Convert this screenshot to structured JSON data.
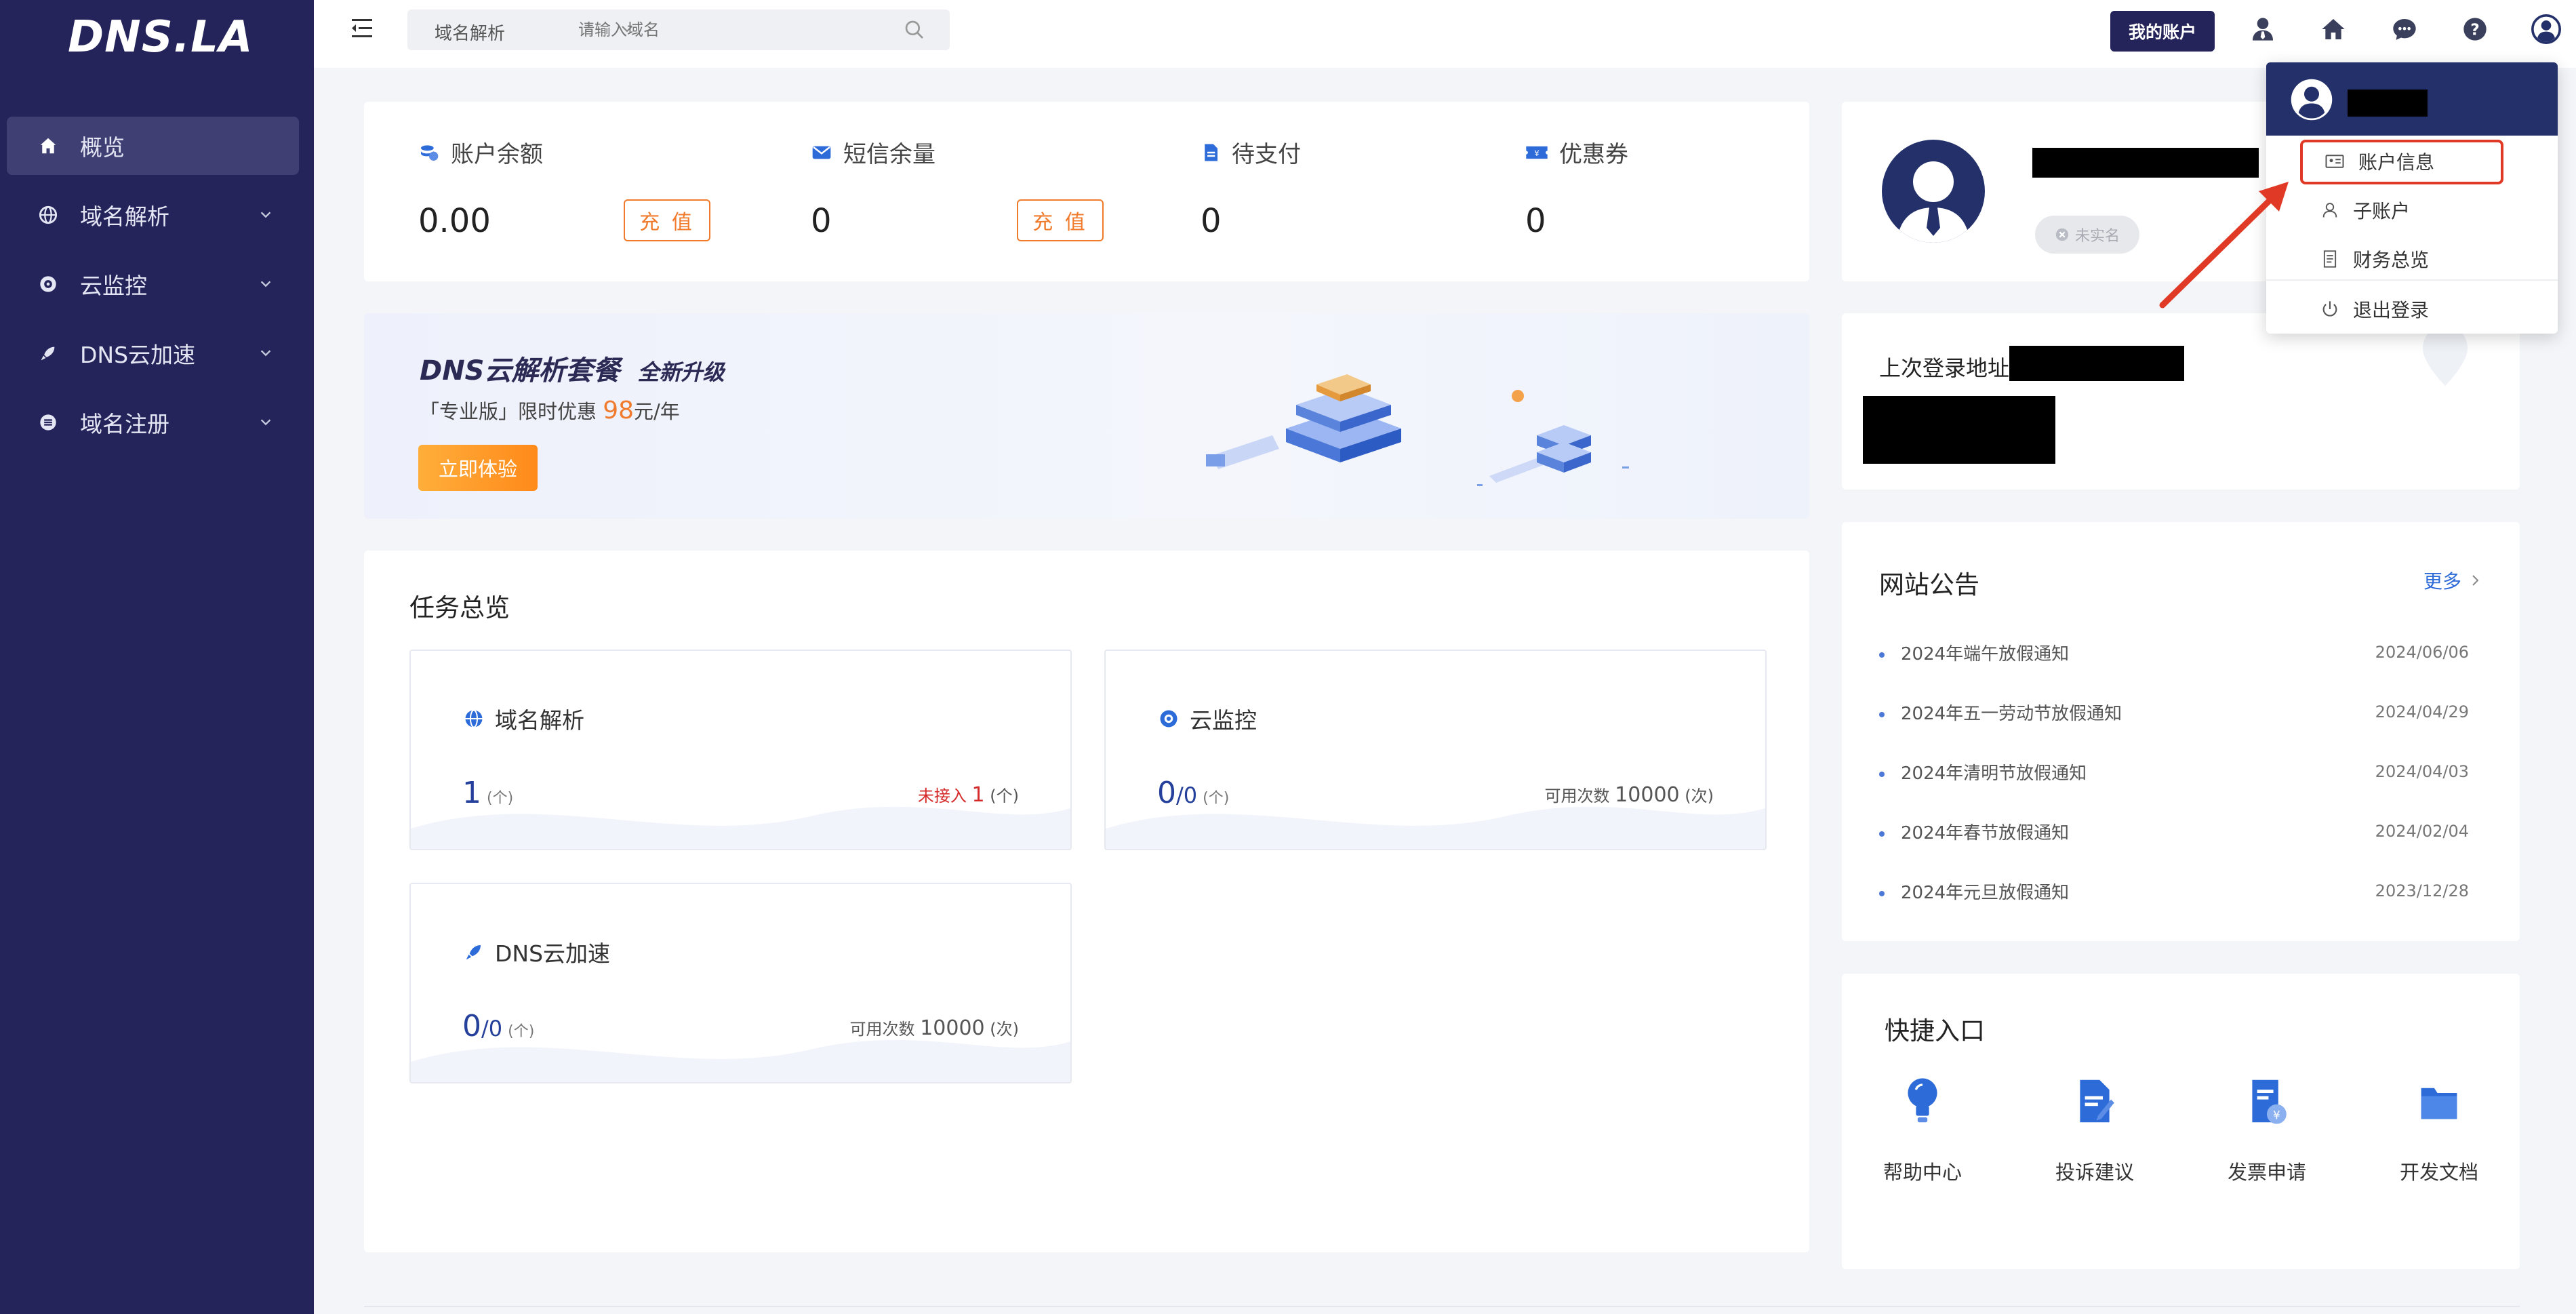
{
  "brand": {
    "logo": "DNS.LA"
  },
  "sidebar": {
    "items": [
      {
        "label": "概览",
        "icon": "home-icon",
        "active": true
      },
      {
        "label": "域名解析",
        "icon": "globe-icon"
      },
      {
        "label": "云监控",
        "icon": "monitor-icon"
      },
      {
        "label": "DNS云加速",
        "icon": "rocket-icon"
      },
      {
        "label": "域名注册",
        "icon": "register-icon"
      }
    ]
  },
  "topbar": {
    "search_select": "域名解析",
    "search_placeholder": "请输入域名",
    "account_button": "我的账户"
  },
  "balance": {
    "items": [
      {
        "label": "账户余额",
        "value": "0.00",
        "action": "充 值",
        "icon": "coins-icon"
      },
      {
        "label": "短信余量",
        "value": "0",
        "action": "充 值",
        "icon": "envelope-icon"
      },
      {
        "label": "待支付",
        "value": "0",
        "icon": "document-icon"
      },
      {
        "label": "优惠券",
        "value": "0",
        "icon": "ticket-icon"
      }
    ]
  },
  "banner": {
    "title": "DNS云解析套餐",
    "title_suffix": "全新升级",
    "sub_prefix": "「专业版」限时优惠 ",
    "price": "98",
    "sub_suffix": "元/年",
    "button": "立即体验"
  },
  "tasks": {
    "title": "任务总览",
    "items": [
      {
        "name": "域名解析",
        "count": "1",
        "total": "",
        "unit": "(个)",
        "right_label": "未接入",
        "right_value": "1",
        "right_unit": "(个)",
        "icon": "globe-icon"
      },
      {
        "name": "云监控",
        "count": "0",
        "total": "/0",
        "unit": "(个)",
        "right_label": "可用次数",
        "right_value": "10000",
        "right_unit": "(次)",
        "icon": "monitor-icon"
      },
      {
        "name": "DNS云加速",
        "count": "0",
        "total": "/0",
        "unit": "(个)",
        "right_label": "可用次数",
        "right_value": "10000",
        "right_unit": "(次)",
        "icon": "rocket-icon"
      }
    ]
  },
  "profile": {
    "realname_status": "未实名"
  },
  "last_login": {
    "label": "上次登录地址"
  },
  "notices": {
    "title": "网站公告",
    "more": "更多",
    "items": [
      {
        "title": "2024年端午放假通知",
        "date": "2024/06/06"
      },
      {
        "title": "2024年五一劳动节放假通知",
        "date": "2024/04/29"
      },
      {
        "title": "2024年清明节放假通知",
        "date": "2024/04/03"
      },
      {
        "title": "2024年春节放假通知",
        "date": "2024/02/04"
      },
      {
        "title": "2024年元旦放假通知",
        "date": "2023/12/28"
      }
    ]
  },
  "quick": {
    "title": "快捷入口",
    "items": [
      {
        "label": "帮助中心",
        "icon": "lightbulb-icon"
      },
      {
        "label": "投诉建议",
        "icon": "edit-document-icon"
      },
      {
        "label": "发票申请",
        "icon": "invoice-icon"
      },
      {
        "label": "开发文档",
        "icon": "folder-icon"
      }
    ]
  },
  "dropdown": {
    "items": [
      {
        "label": "账户信息",
        "icon": "id-card-icon"
      },
      {
        "label": "子账户",
        "icon": "user-icon"
      },
      {
        "label": "财务总览",
        "icon": "receipt-icon"
      },
      {
        "label": "退出登录",
        "icon": "power-icon"
      }
    ]
  },
  "colors": {
    "sidebar": "#24235a",
    "accent": "#f07b2c",
    "primary": "#2d6bd8",
    "highlight": "#e03a26"
  }
}
